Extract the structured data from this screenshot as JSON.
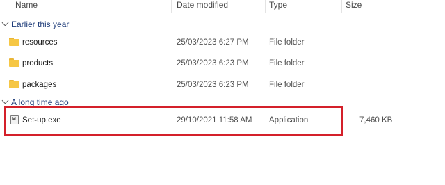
{
  "columns": {
    "name": "Name",
    "date": "Date modified",
    "type": "Type",
    "size": "Size"
  },
  "groups": [
    {
      "label": "Earlier this year",
      "items": [
        {
          "name": "resources",
          "date": "25/03/2023 6:27 PM",
          "type": "File folder",
          "size": "",
          "icon": "folder-icon"
        },
        {
          "name": "products",
          "date": "25/03/2023 6:23 PM",
          "type": "File folder",
          "size": "",
          "icon": "folder-icon"
        },
        {
          "name": "packages",
          "date": "25/03/2023 6:23 PM",
          "type": "File folder",
          "size": "",
          "icon": "folder-icon"
        }
      ]
    },
    {
      "label": "A long time ago",
      "items": [
        {
          "name": "Set-up.exe",
          "date": "29/10/2021 11:58 AM",
          "type": "Application",
          "size": "7,460 KB",
          "icon": "application-icon"
        }
      ]
    }
  ],
  "colors": {
    "group_header": "#1f3d7a",
    "folder": "#f6c745",
    "highlight": "#d4202a"
  }
}
